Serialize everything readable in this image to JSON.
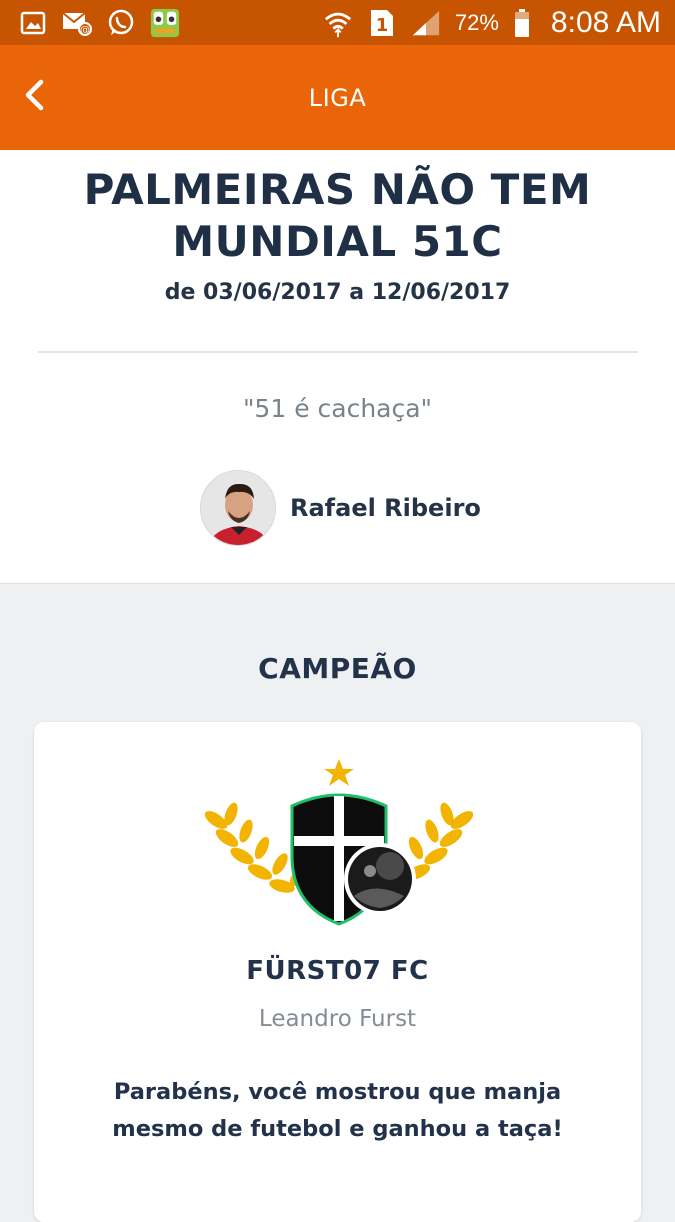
{
  "status_bar": {
    "battery_percent": "72%",
    "time": "8:08 AM",
    "sim_label": "1",
    "left_icons": [
      "gallery-icon",
      "email-icon",
      "whatsapp-icon",
      "app-icon"
    ],
    "right_icons": [
      "wifi-icon",
      "sim-icon",
      "signal-icon",
      "battery-icon"
    ]
  },
  "app_bar": {
    "title": "LIGA",
    "back_icon": "chevron-left-icon"
  },
  "league": {
    "title_line1": "PALMEIRAS NÃO TEM",
    "title_line2": "MUNDIAL 51C",
    "dates": "de 03/06/2017 a 12/06/2017",
    "motto": "\"51 é cachaça\"",
    "owner_name": "Rafael Ribeiro"
  },
  "champion": {
    "section_title": "CAMPEÃO",
    "team_name": "FÜRST07 FC",
    "owner_name": "Leandro Furst",
    "message_line1": "Parabéns, você mostrou que manja",
    "message_line2": "mesmo de futebol e ganhou a taça!"
  },
  "colors": {
    "status_bar": "#c75400",
    "app_bar": "#ea6507",
    "title_text": "#1f2f46",
    "laurel": "#f2b301",
    "crest_outline": "#1fbf6a"
  }
}
